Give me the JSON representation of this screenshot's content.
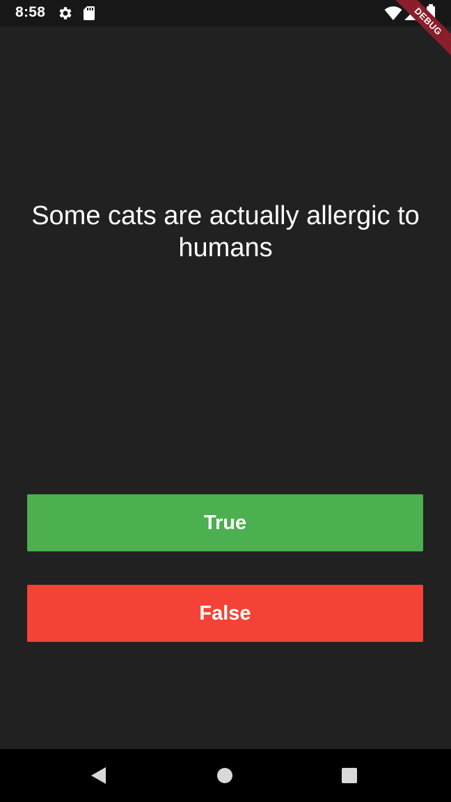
{
  "status_bar": {
    "time": "8:58",
    "icons": [
      "gear-icon",
      "sd-card-icon",
      "wifi-icon",
      "signal-icon",
      "battery-icon"
    ]
  },
  "debug_banner": {
    "label": "DEBUG",
    "color": "#8b1e2b"
  },
  "quiz": {
    "question": "Some cats are actually allergic to humans",
    "true_label": "True",
    "false_label": "False"
  },
  "colors": {
    "background": "#212121",
    "true_button": "#4caf50",
    "false_button": "#f44336"
  },
  "nav_bar": {
    "icons": [
      "back-icon",
      "home-icon",
      "recents-icon"
    ]
  }
}
